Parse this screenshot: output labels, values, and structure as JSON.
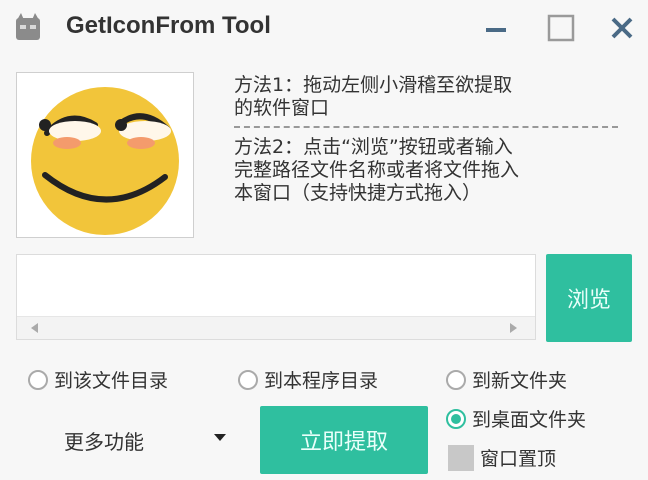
{
  "window": {
    "title": "GetIconFrom Tool",
    "icons": {
      "app": "app-icon",
      "minimize": "minimize-icon",
      "maximize": "maximize-icon",
      "close": "close-icon"
    }
  },
  "preview": {
    "icon": "smiley-face-icon"
  },
  "instructions": {
    "method1_line1": "方法1：拖动左侧小滑稽至欲提取",
    "method1_line2": "的软件窗口",
    "method2_line1": "方法2：点击“浏览”按钮或者输入",
    "method2_line2": "完整路径文件名称或者将文件拖入",
    "method2_line3": "本窗口（支持快捷方式拖入）"
  },
  "path_input": {
    "value": "",
    "placeholder": ""
  },
  "browse_button": {
    "label": "浏览"
  },
  "options": {
    "to_file_dir": "到该文件目录",
    "to_program_dir": "到本程序目录",
    "to_new_folder": "到新文件夹",
    "to_desktop_folder": "到桌面文件夹",
    "selected": "to_desktop_folder"
  },
  "more_functions": {
    "label": "更多功能"
  },
  "extract_button": {
    "label": "立即提取"
  },
  "topmost_checkbox": {
    "label": "窗口置顶",
    "checked": false
  },
  "colors": {
    "accent": "#2fbf9f",
    "face": "#f2c53a"
  }
}
